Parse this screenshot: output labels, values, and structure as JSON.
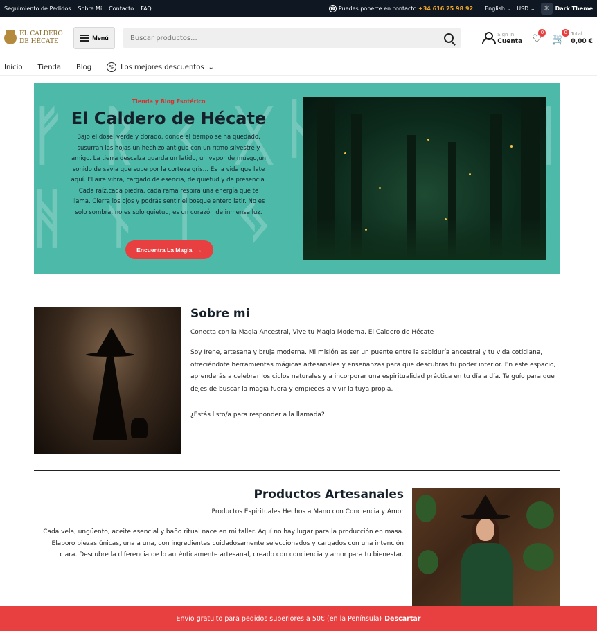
{
  "topbar": {
    "links": [
      "Seguimiento de Pedidos",
      "Sobre Mí",
      "Contacto",
      "FAQ"
    ],
    "contact_text": "Puedes ponerte en contacto",
    "phone": "+34 616 25 98 92",
    "language": "English",
    "currency": "USD",
    "theme_label": "Dark Theme"
  },
  "header": {
    "logo_line1": "EL CALDERO",
    "logo_line2": "DE HÉCATE",
    "menu_label": "Menú",
    "search_placeholder": "Buscar productos...",
    "account_small": "Sign In",
    "account_big": "Cuenta",
    "wishlist_count": "0",
    "cart_count": "0",
    "cart_small": "Total",
    "cart_total": "0,00 €"
  },
  "nav": {
    "items": [
      "Inicio",
      "Tienda",
      "Blog"
    ],
    "best_label": "Los mejores descuentos"
  },
  "hero": {
    "subtitle": "Tienda y Blog Esotérico",
    "title": "El Caldero de Hécate",
    "description": "Bajo el dosel verde y dorado, donde el tiempo se ha quedado, susurran las hojas un hechizo antiguo con un ritmo silvestre y amigo. La tierra descalza guarda un latido, un vapor de musgo,un sonido de savia que sube por la corteza gris… Es la vida que late aquí. El aire vibra, cargado de esencia, de quietud y de presencia. Cada raíz,cada piedra, cada rama respira una energía que te llama. Cierra los ojos y podrás sentir el bosque entero latir. No es solo sombra, no es solo quietud, es un corazón de inmensa luz.",
    "button_label": "Encuentra La Magia"
  },
  "about": {
    "title": "Sobre mi",
    "lead": "Conecta con la Magia Ancestral, Vive tu Magia Moderna. El Caldero de Hécate",
    "paragraph": "Soy Irene, artesana y bruja moderna. Mi misión es ser un puente entre la sabiduría ancestral y tu vida cotidiana, ofreciéndote herramientas mágicas artesanales y enseñanzas para que descubras tu poder interior. En este espacio, aprenderás a celebrar los ciclos naturales y a incorporar una espiritualidad práctica en tu día a día. Te guío para que dejes de buscar la magia fuera y empieces a vivir la tuya propia.",
    "question": "¿Estás listo/a para responder a la llamada?"
  },
  "products": {
    "title": "Productos Artesanales",
    "lead": "Productos Espirituales Hechos a Mano con Conciencia y Amor",
    "paragraph": "Cada vela, ungüento, aceite esencial y baño ritual nace en mi taller. Aquí no hay lugar para la producción en masa. Elaboro piezas únicas, una a una, con ingredientes cuidadosamente seleccionados y cargados con una intención clara. Descubre la diferencia de lo auténticamente artesanal, creado con conciencia y amor para tu bienestar."
  },
  "banner": {
    "text": "Envío gratuito para pedidos superiores a 50€ (en la Península)",
    "dismiss": "Descartar"
  }
}
